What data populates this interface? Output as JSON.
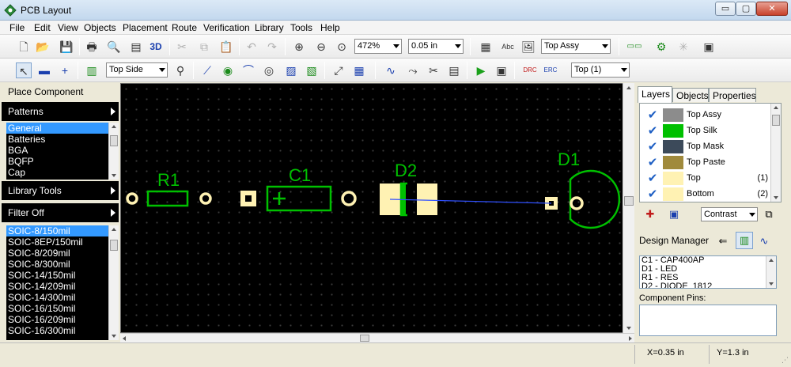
{
  "window": {
    "title": "PCB Layout",
    "minimize_label": "▭",
    "maximize_label": "▢",
    "close_label": "✕"
  },
  "menu": [
    "File",
    "Edit",
    "View",
    "Objects",
    "Placement",
    "Route",
    "Verification",
    "Library",
    "Tools",
    "Help"
  ],
  "toolbar1": {
    "zoom_value": "472%",
    "grid_value": "0.05 in",
    "layer_view_value": "Top Assy",
    "text3d_label": "3D"
  },
  "toolbar2": {
    "side_value": "Top Side",
    "layer_value": "Top (1)"
  },
  "left_panel": {
    "place_component_label": "Place Component",
    "patterns_label": "Patterns",
    "library_tools_label": "Library Tools",
    "filter_label": "Filter Off",
    "pattern_categories": [
      "General",
      "Batteries",
      "BGA",
      "BQFP",
      "Cap"
    ],
    "selected_category": "General",
    "patterns": [
      "SOIC-8/150mil",
      "SOIC-8EP/150mil",
      "SOIC-8/209mil",
      "SOIC-8/300mil",
      "SOIC-14/150mil",
      "SOIC-14/209mil",
      "SOIC-14/300mil",
      "SOIC-16/150mil",
      "SOIC-16/209mil",
      "SOIC-16/300mil"
    ],
    "selected_pattern": "SOIC-8/150mil"
  },
  "canvas": {
    "components": {
      "r1": "R1",
      "c1": "C1",
      "d2": "D2",
      "d1": "D1"
    },
    "colors": {
      "silk": "#00c000",
      "pad": "#fff2b3",
      "trace": "#3050ff",
      "background": "#000000"
    }
  },
  "right_panel": {
    "tabs": [
      "Layers",
      "Objects",
      "Properties"
    ],
    "active_tab": "Layers",
    "layers": [
      {
        "name": "Top Assy",
        "color": "#8c8c8c",
        "num": ""
      },
      {
        "name": "Top Silk",
        "color": "#00c000",
        "num": ""
      },
      {
        "name": "Top Mask",
        "color": "#3c4a5a",
        "num": ""
      },
      {
        "name": "Top Paste",
        "color": "#a08a3c",
        "num": ""
      },
      {
        "name": "Top",
        "color": "#fff2b3",
        "num": "(1)"
      },
      {
        "name": "Bottom",
        "color": "#fff2b3",
        "num": "(2)"
      }
    ],
    "contrast_value": "Contrast",
    "design_manager_label": "Design Manager",
    "design_items": [
      "C1 - CAP400AP",
      "D1 - LED",
      "R1 - RES",
      "D2 - DIODE_1812"
    ],
    "component_pins_label": "Component Pins:"
  },
  "status": {
    "x": "X=0.35 in",
    "y": "Y=1.3 in"
  }
}
